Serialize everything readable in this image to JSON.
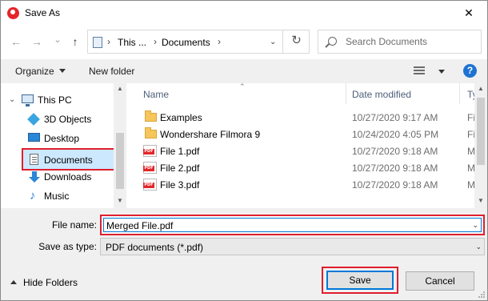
{
  "window": {
    "title": "Save As",
    "close_glyph": "✕"
  },
  "nav": {
    "back_glyph": "←",
    "forward_glyph": "→",
    "dropdown_glyph": "⌄",
    "up_glyph": "↑",
    "refresh_glyph": "↻",
    "breadcrumb": [
      "This ...",
      "Documents"
    ],
    "search_placeholder": "Search Documents"
  },
  "toolbar": {
    "organize_label": "Organize",
    "new_folder_label": "New folder",
    "help_glyph": "?"
  },
  "navpane": {
    "items": [
      {
        "label": "This PC",
        "icon": "pc-icon"
      },
      {
        "label": "3D Objects",
        "icon": "3d-objects-icon"
      },
      {
        "label": "Desktop",
        "icon": "desktop-icon"
      },
      {
        "label": "Documents",
        "icon": "documents-icon",
        "selected": true
      },
      {
        "label": "Downloads",
        "icon": "downloads-icon"
      },
      {
        "label": "Music",
        "icon": "music-icon"
      }
    ]
  },
  "filelist": {
    "headers": {
      "name": "Name",
      "date": "Date modified",
      "type": "Ty"
    },
    "rows": [
      {
        "name": "Examples",
        "date": "10/27/2020 9:17 AM",
        "type": "Fi",
        "kind": "folder"
      },
      {
        "name": "Wondershare Filmora 9",
        "date": "10/24/2020 4:05 PM",
        "type": "Fi",
        "kind": "folder"
      },
      {
        "name": "File 1.pdf",
        "date": "10/27/2020 9:18 AM",
        "type": "M",
        "kind": "pdf"
      },
      {
        "name": "File 2.pdf",
        "date": "10/27/2020 9:18 AM",
        "type": "M",
        "kind": "pdf"
      },
      {
        "name": "File 3.pdf",
        "date": "10/27/2020 9:18 AM",
        "type": "M",
        "kind": "pdf"
      }
    ],
    "pdf_badge": "PDF"
  },
  "form": {
    "filename_label": "File name:",
    "filename_value": "Merged File.pdf",
    "savetype_label": "Save as type:",
    "savetype_value": "PDF documents (*.pdf)"
  },
  "footer": {
    "hide_folders_label": "Hide Folders",
    "save_label": "Save",
    "cancel_label": "Cancel"
  },
  "colors": {
    "highlight_border": "#e01e2d",
    "selection_bg": "#cce8ff",
    "accent_blue": "#0078d7"
  }
}
